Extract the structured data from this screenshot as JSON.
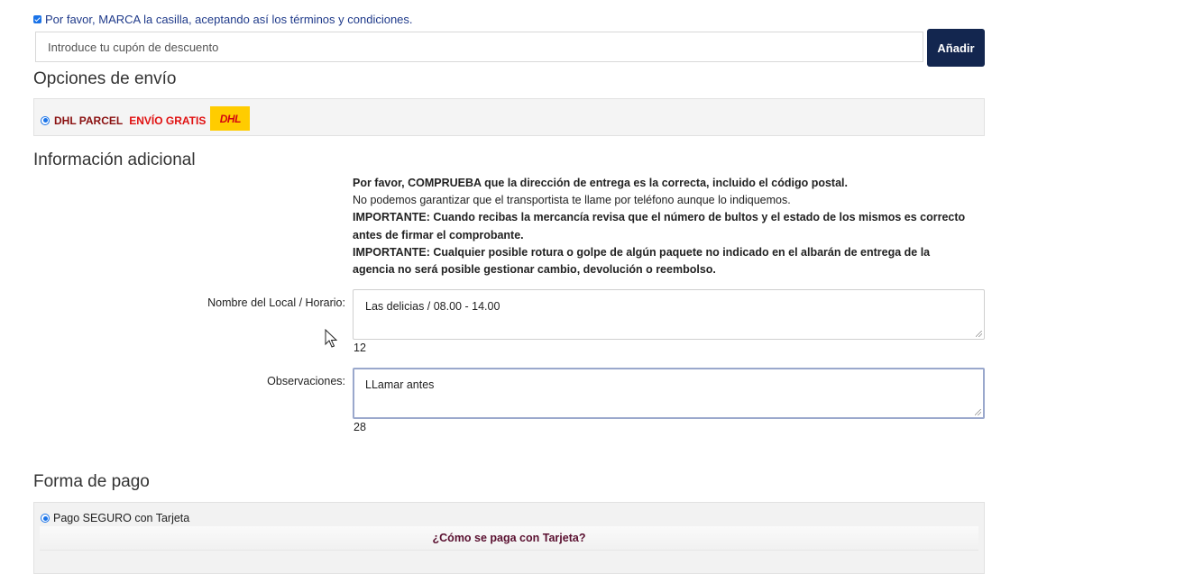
{
  "terms": {
    "label": "Por favor, MARCA la casilla, aceptando así los términos y condiciones.",
    "checked": true
  },
  "coupon": {
    "placeholder": "Introduce tu cupón de descuento",
    "button_label": "Añadir"
  },
  "shipping": {
    "title": "Opciones de envío",
    "option": {
      "name": "DHL PARCEL",
      "tag": "ENVÍO GRATIS",
      "logo_text": "DHL",
      "selected": true
    }
  },
  "additional": {
    "title": "Información adicional",
    "notice": {
      "line1": "Por favor, COMPRUEBA que la dirección de entrega es la correcta, incluido el código postal.",
      "line2": "No podemos garantizar que el transportista te llame por teléfono aunque lo indiquemos.",
      "line3": "IMPORTANTE: Cuando recibas la mercancía revisa que el número de bultos y el estado de los mismos es correcto antes de firmar el comprobante.",
      "line4": "IMPORTANTE: Cualquier posible rotura o golpe de algún paquete no indicado en el albarán de entrega de la agencia no será posible gestionar cambio, devolución o reembolso."
    },
    "local_field": {
      "label": "Nombre del Local / Horario:",
      "value": "Las delicias / 08.00 - 14.00",
      "counter": "12"
    },
    "obs_field": {
      "label": "Observaciones:",
      "value": "LLamar antes",
      "counter": "28"
    }
  },
  "payment": {
    "title": "Forma de pago",
    "option": {
      "label": "Pago SEGURO con Tarjeta",
      "selected": true
    },
    "how_link": "¿Cómo se paga con Tarjeta?"
  },
  "colors": {
    "accent": "#1a73e8",
    "button_bg": "#13264f",
    "dhl_yellow": "#ffcc00",
    "dhl_red": "#d40511"
  }
}
